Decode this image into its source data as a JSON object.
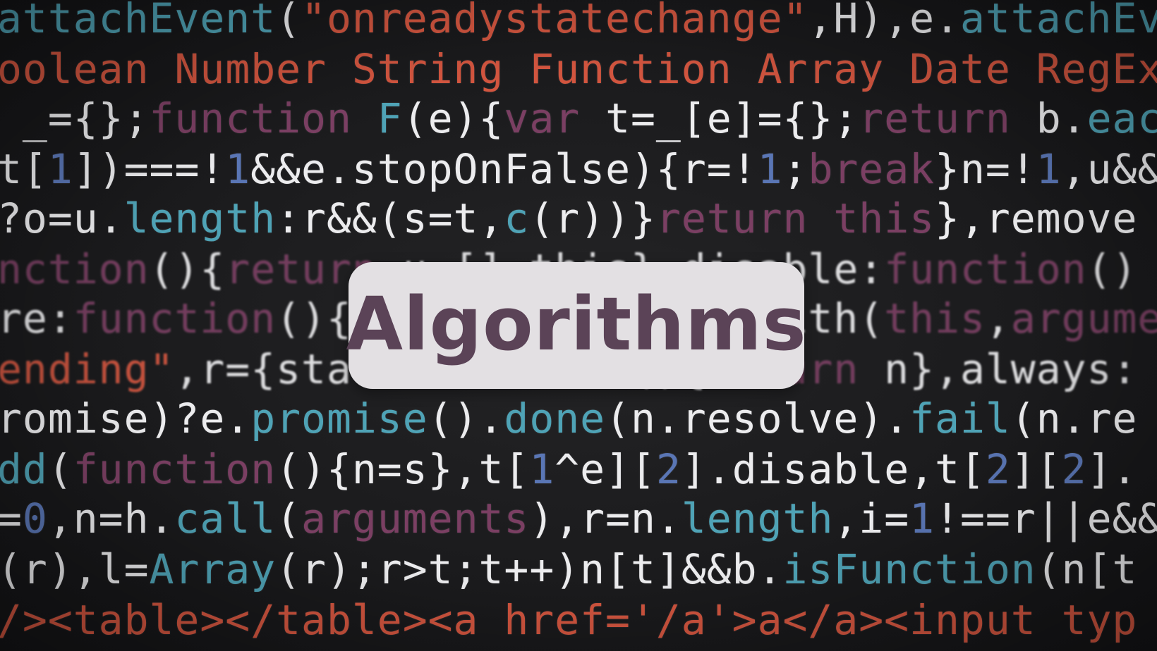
{
  "title": "Algorithms",
  "colors": {
    "card_background": "#e3e0e3",
    "title_text": "#5b4357",
    "code_white": "#ececee",
    "code_red": "#d2553f",
    "code_teal": "#4fa3b6",
    "code_purple": "#7b3f63",
    "code_blue": "#5a76b5"
  },
  "code_lines": [
    [
      [
        "teal",
        "attachEvent"
      ],
      [
        "white",
        "("
      ],
      [
        "red",
        "\"onreadystatechange\""
      ],
      [
        "white",
        ",H),e."
      ],
      [
        "teal",
        "attachEv"
      ]
    ],
    [
      [
        "red",
        "oolean Number String Function Array Date RegEx"
      ]
    ],
    [
      [
        "white",
        " _={};"
      ],
      [
        "purple",
        "function"
      ],
      [
        "white",
        " "
      ],
      [
        "teal",
        "F"
      ],
      [
        "white",
        "(e){"
      ],
      [
        "purple",
        "var"
      ],
      [
        "white",
        " t=_[e]={};"
      ],
      [
        "purple",
        "return"
      ],
      [
        "white",
        " b."
      ],
      [
        "teal",
        "eac"
      ]
    ],
    [
      [
        "white",
        "t["
      ],
      [
        "blue",
        "1"
      ],
      [
        "white",
        "])===!"
      ],
      [
        "blue",
        "1"
      ],
      [
        "white",
        "&&e.stopOnFalse){r=!"
      ],
      [
        "blue",
        "1"
      ],
      [
        "white",
        ";"
      ],
      [
        "purple",
        "break"
      ],
      [
        "white",
        "}n=!"
      ],
      [
        "blue",
        "1"
      ],
      [
        "white",
        ",u&&"
      ]
    ],
    [
      [
        "white",
        "?o=u."
      ],
      [
        "teal",
        "length"
      ],
      [
        "white",
        ":r&&(s=t,"
      ],
      [
        "teal",
        "c"
      ],
      [
        "white",
        "(r))}"
      ],
      [
        "purple",
        "return this"
      ],
      [
        "white",
        "},remove"
      ]
    ],
    [
      [
        "purple",
        "nction"
      ],
      [
        "white",
        "(){"
      ],
      [
        "purple",
        "return"
      ],
      [
        "white",
        " u=[],this},disable:"
      ],
      [
        "purple",
        "function"
      ],
      [
        "white",
        "()"
      ]
    ],
    [
      [
        "white",
        "re:"
      ],
      [
        "purple",
        "function"
      ],
      [
        "white",
        "(){"
      ],
      [
        "white",
        "return this.fireWith("
      ],
      [
        "purple",
        "this"
      ],
      [
        "white",
        ","
      ],
      [
        "purple",
        "argument"
      ]
    ],
    [
      [
        "red",
        "ending\""
      ],
      [
        "white",
        ",r={state:function(){"
      ],
      [
        "purple",
        "return"
      ],
      [
        "white",
        " n},always:"
      ]
    ],
    [
      [
        "white",
        "romise)?e."
      ],
      [
        "teal",
        "promise"
      ],
      [
        "white",
        "()."
      ],
      [
        "teal",
        "done"
      ],
      [
        "white",
        "(n.resolve)."
      ],
      [
        "teal",
        "fail"
      ],
      [
        "white",
        "(n.re"
      ]
    ],
    [
      [
        "teal",
        "dd"
      ],
      [
        "white",
        "("
      ],
      [
        "purple",
        "function"
      ],
      [
        "white",
        "(){n=s},t["
      ],
      [
        "blue",
        "1"
      ],
      [
        "white",
        "^e]["
      ],
      [
        "blue",
        "2"
      ],
      [
        "white",
        "].disable,t["
      ],
      [
        "blue",
        "2"
      ],
      [
        "white",
        "]["
      ],
      [
        "blue",
        "2"
      ],
      [
        "white",
        "]."
      ]
    ],
    [
      [
        "white",
        "="
      ],
      [
        "blue",
        "0"
      ],
      [
        "white",
        ",n=h."
      ],
      [
        "teal",
        "call"
      ],
      [
        "white",
        "("
      ],
      [
        "purple",
        "arguments"
      ],
      [
        "white",
        "),r=n."
      ],
      [
        "teal",
        "length"
      ],
      [
        "white",
        ",i="
      ],
      [
        "blue",
        "1"
      ],
      [
        "white",
        "!==r||e&&"
      ]
    ],
    [
      [
        "white",
        "(r),l="
      ],
      [
        "teal",
        "Array"
      ],
      [
        "white",
        "(r);r>t;t++)n[t]&&b."
      ],
      [
        "teal",
        "isFunction"
      ],
      [
        "white",
        "(n[t"
      ]
    ],
    [
      [
        "red",
        "/><table></table><a href='/a'>a</a><input typ"
      ]
    ]
  ]
}
